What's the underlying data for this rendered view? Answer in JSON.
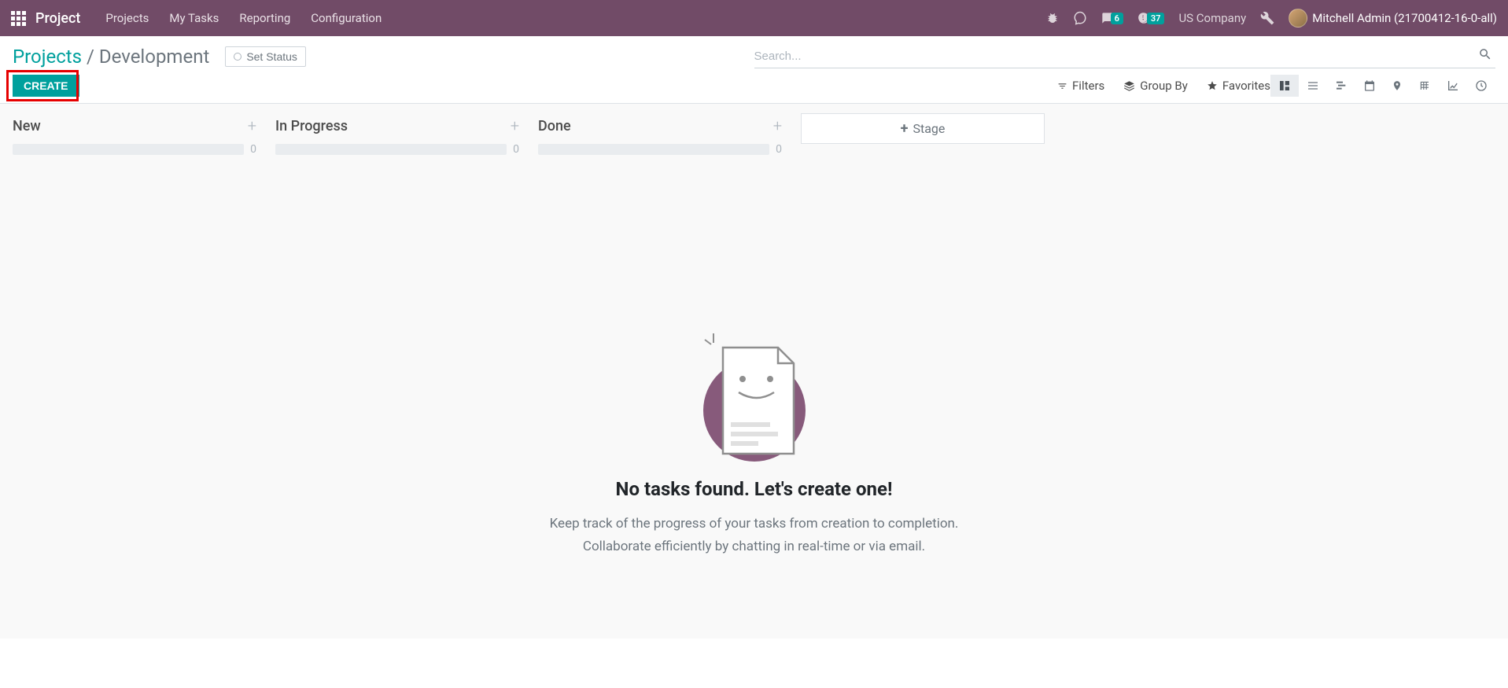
{
  "navbar": {
    "brand": "Project",
    "menu": [
      "Projects",
      "My Tasks",
      "Reporting",
      "Configuration"
    ],
    "messages_badge": "6",
    "activities_badge": "37",
    "company": "US Company",
    "user": "Mitchell Admin (21700412-16-0-all)"
  },
  "breadcrumb": {
    "parent": "Projects",
    "current": "Development"
  },
  "status_button": "Set Status",
  "create_button": "CREATE",
  "search_placeholder": "Search...",
  "filters": {
    "filters": "Filters",
    "group_by": "Group By",
    "favorites": "Favorites"
  },
  "kanban_columns": [
    {
      "title": "New",
      "count": "0"
    },
    {
      "title": "In Progress",
      "count": "0"
    },
    {
      "title": "Done",
      "count": "0"
    }
  ],
  "add_stage": "Stage",
  "empty": {
    "title": "No tasks found. Let's create one!",
    "line1": "Keep track of the progress of your tasks from creation to completion.",
    "line2": "Collaborate efficiently by chatting in real-time or via email."
  }
}
